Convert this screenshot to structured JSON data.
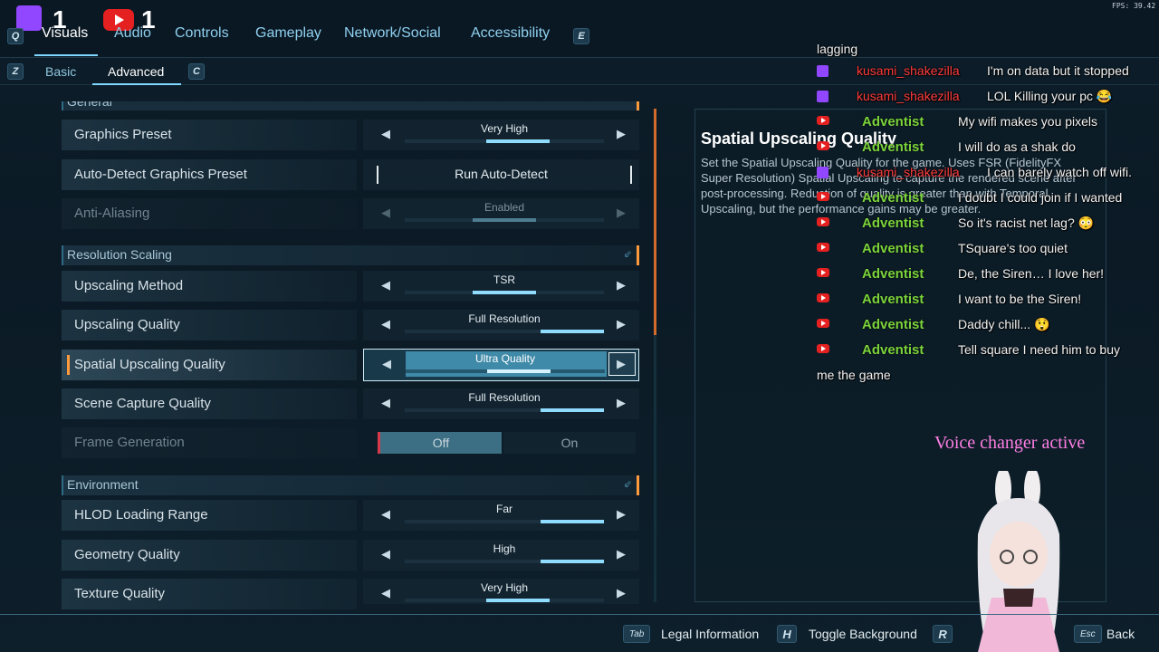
{
  "fps": "FPS: 39.42",
  "stream": {
    "twitch_count": "1",
    "youtube_count": "1"
  },
  "tabs": {
    "prev_key": "Q",
    "next_key": "E",
    "items": [
      {
        "label": "Visuals",
        "active": true
      },
      {
        "label": "Audio"
      },
      {
        "label": "Controls"
      },
      {
        "label": "Gameplay"
      },
      {
        "label": "Network/Social"
      },
      {
        "label": "Accessibility"
      }
    ]
  },
  "subtabs": {
    "prev_key": "Z",
    "next_key": "C",
    "items": [
      {
        "label": "Basic"
      },
      {
        "label": "Advanced",
        "active": true
      }
    ]
  },
  "section_cut": "General",
  "settings": {
    "graphics_preset": {
      "label": "Graphics Preset",
      "value": "Very High",
      "level": 0.6
    },
    "auto_detect": {
      "label": "Auto-Detect Graphics Preset",
      "value": "Run Auto-Detect"
    },
    "anti_aliasing": {
      "label": "Anti-Aliasing",
      "value": "Enabled",
      "level": 0.5
    },
    "resolution_section": "Resolution Scaling",
    "upscaling_method": {
      "label": "Upscaling Method",
      "value": "TSR",
      "level": 0.5
    },
    "upscaling_quality": {
      "label": "Upscaling Quality",
      "value": "Full Resolution",
      "level": 1.0
    },
    "spatial_upscaling": {
      "label": "Spatial Upscaling Quality",
      "value": "Ultra Quality",
      "level": 0.6
    },
    "scene_capture": {
      "label": "Scene Capture Quality",
      "value": "Full Resolution",
      "level": 1.0
    },
    "frame_generation": {
      "label": "Frame Generation",
      "off": "Off",
      "on": "On",
      "value": "Off"
    },
    "environment_section": "Environment",
    "hlod": {
      "label": "HLOD Loading Range",
      "value": "Far",
      "level": 1.0
    },
    "geometry": {
      "label": "Geometry Quality",
      "value": "High",
      "level": 1.0
    },
    "texture": {
      "label": "Texture Quality",
      "value": "Very High",
      "level": 0.6
    }
  },
  "description": {
    "title": "Spatial Upscaling Quality",
    "body": "Set the Spatial Upscaling Quality for the game. Uses FSR (FidelityFX Super Resolution) Spatial Upscaling to capture the rendered scene after post-processing. Reduction of quality is greater than with Temporal Upscaling, but the performance gains may be greater."
  },
  "chat": {
    "top_fragment": "lagging",
    "messages": [
      {
        "platform": "twitch",
        "user": "kusami_shakezilla",
        "text": "I'm on data but it stopped"
      },
      {
        "platform": "twitch",
        "user": "kusami_shakezilla",
        "text": "LOL Killing your pc 😂"
      },
      {
        "platform": "youtube",
        "user": "Adventist",
        "text": "My wifi makes you pixels"
      },
      {
        "platform": "youtube",
        "user": "Adventist",
        "text": "I will do as a shak do"
      },
      {
        "platform": "twitch",
        "user": "kusami_shakezilla",
        "text": "I can barely watch off wifi."
      },
      {
        "platform": "youtube",
        "user": "Adventist",
        "text": "I doubt I could join if I wanted"
      },
      {
        "platform": "youtube",
        "user": "Adventist",
        "text": "So it's racist net lag? 😳"
      },
      {
        "platform": "youtube",
        "user": "Adventist",
        "text": "TSquare's too quiet"
      },
      {
        "platform": "youtube",
        "user": "Adventist",
        "text": "De, the Siren… I love her!"
      },
      {
        "platform": "youtube",
        "user": "Adventist",
        "text": "I want to be the Siren!"
      },
      {
        "platform": "youtube",
        "user": "Adventist",
        "text": "Daddy chill... 😲"
      },
      {
        "platform": "youtube",
        "user": "Adventist",
        "text": "Tell square I need him to buy"
      }
    ],
    "wrap_line": "me the game"
  },
  "voice_changer": "Voice changer active",
  "bottom": {
    "legal_key": "Tab",
    "legal": "Legal Information",
    "bg_key": "H",
    "bg": "Toggle Background",
    "reset_key": "R",
    "back_key": "Esc",
    "back": "Back"
  },
  "colors": {
    "accent": "#7fd8ff",
    "selection_marker": "#ff9a3c",
    "twitch": "#9146ff",
    "youtube": "#e52020",
    "chat_name": "#ff3b3b",
    "voice": "#ff7fe3"
  }
}
